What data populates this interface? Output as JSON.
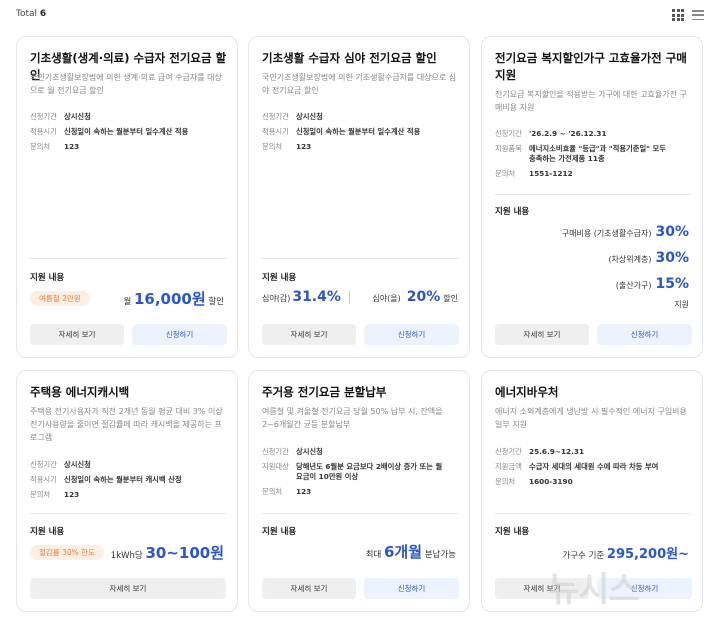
{
  "header": {
    "total_label": "Total",
    "total_count": "6",
    "grid_view_icon": "grid-icon",
    "list_view_icon": "list-icon"
  },
  "buttons": {
    "detail": "자세히 보기",
    "apply": "신청하기"
  },
  "labels": {
    "support": "지원 내용"
  },
  "cards": [
    {
      "title": "기초생활(생계·의료) 수급자 전기요금 할인",
      "desc": "국민기초생활보장법에 의한 생계·의료 급여 수급자를 대상으로 월 전기요금 할인",
      "info": [
        {
          "k": "신청기간",
          "v": "상시신청"
        },
        {
          "k": "적용시기",
          "v": "신청일이 속하는 월분부터 일수계산 적용"
        },
        {
          "k": "문의처",
          "v": "123"
        }
      ],
      "tag": "여름철 2만원",
      "amount_prefix": "월",
      "amount_value": "16,000원",
      "amount_suffix": "할인"
    },
    {
      "title": "기초생활 수급자 심야 전기요금 할인",
      "desc": "국민기초생활보장법에 의한 기초생활수급자를 대상으로 심야 전기요금 할인",
      "info": [
        {
          "k": "신청기간",
          "v": "상시신청"
        },
        {
          "k": "적용시기",
          "v": "신청일이 속하는 월분부터 일수계산 적용"
        },
        {
          "k": "문의처",
          "v": "123"
        }
      ],
      "split": [
        {
          "label": "심야(갑)",
          "value": "31.4%"
        },
        {
          "label": "심야(을)",
          "value": "20%"
        }
      ],
      "split_suffix": "할인"
    },
    {
      "title": "전기요금 복지할인가구 고효율가전 구매지원",
      "desc": "전기요금 복지할인을 적용받는 가구에 대한 고효율가전 구매비용 지원",
      "info": [
        {
          "k": "신청기간",
          "v": "'26.2.9 ~ '26.12.31"
        },
        {
          "k": "지원품목",
          "v": "에너지소비효율 \"등급\"과 \"적용기준일\" 모두 충족하는 가전제품 11종"
        },
        {
          "k": "문의처",
          "v": "1551-1212"
        }
      ],
      "lines": [
        {
          "label": "구매비용 (기초생활수급자)",
          "value": "30%"
        },
        {
          "label": "(차상위계층)",
          "value": "30%"
        },
        {
          "label": "(출산가구)",
          "value": "15%"
        }
      ],
      "lines_tail": "지원"
    },
    {
      "title": "주택용 에너지캐시백",
      "desc": "주택용 전기사용자가 직전 2개년 동월 평균 대비 3% 이상 전기사용량을 줄이면 절감률에 따라 캐시백을 제공하는 프로그램",
      "info": [
        {
          "k": "신청기간",
          "v": "상시신청"
        },
        {
          "k": "적용시기",
          "v": "신청일이 속하는 월분부터 캐시백 산정"
        },
        {
          "k": "문의처",
          "v": "123"
        }
      ],
      "tag": "절감률 30% 한도",
      "amount_prefix": "1kWh당",
      "amount_value": "30~100원",
      "amount_suffix": ""
    },
    {
      "title": "주거용 전기요금 분할납부",
      "desc": "여름철 및 겨울철 전기요금 당월 50% 납부 시, 잔액을 2~6개월간 균등 분할납부",
      "info": [
        {
          "k": "신청기간",
          "v": "상시신청"
        },
        {
          "k": "지원대상",
          "v": "당해년도 6월분 요금보다 2배이상 증가 또는 월요금이 10만원 이상"
        },
        {
          "k": "문의처",
          "v": "123"
        }
      ],
      "amount_prefix": "최대",
      "amount_value": "6개월",
      "amount_suffix": "분납가능"
    },
    {
      "title": "에너지바우처",
      "desc": "에너지 소외계층에게 냉난방 시 필수적인 에너지 구입비용 일부 지원",
      "info": [
        {
          "k": "신청기간",
          "v": "25.6.9~12.31"
        },
        {
          "k": "지원금액",
          "v": "수급자 세대의 세대원 수에 따라 차등 부여"
        },
        {
          "k": "문의처",
          "v": "1600-3190"
        }
      ],
      "amount_prefix": "가구수 기준",
      "amount_value": "295,200원~",
      "amount_suffix": ""
    }
  ],
  "watermark": "뉴시스"
}
